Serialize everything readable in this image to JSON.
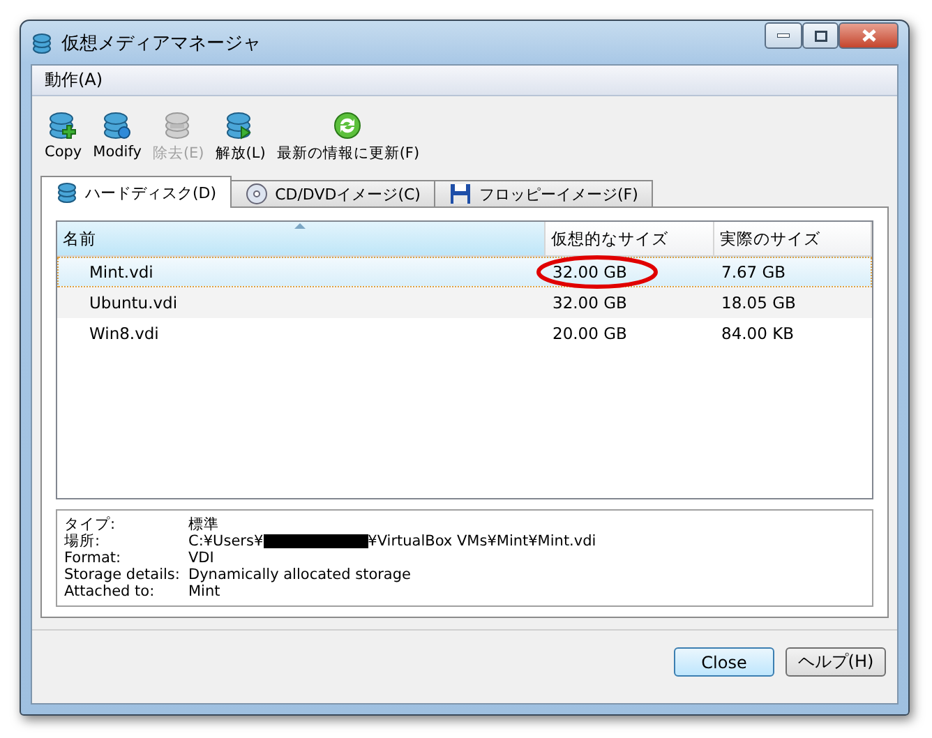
{
  "window": {
    "title": "仮想メディアマネージャ"
  },
  "menu": [
    {
      "label": "動作(A)"
    }
  ],
  "toolbar": [
    {
      "label": "Copy",
      "kind": "copy",
      "disabled": false
    },
    {
      "label": "Modify",
      "kind": "modify",
      "disabled": false
    },
    {
      "label": "除去(E)",
      "kind": "remove",
      "disabled": true
    },
    {
      "label": "解放(L)",
      "kind": "release",
      "disabled": false
    },
    {
      "label": "最新の情報に更新(F)",
      "kind": "refresh",
      "disabled": false
    }
  ],
  "tabs": [
    {
      "label": "ハードディスク(D)",
      "kind": "disk",
      "selected": true
    },
    {
      "label": "CD/DVDイメージ(C)",
      "kind": "cd",
      "selected": false
    },
    {
      "label": "フロッピーイメージ(F)",
      "kind": "floppy",
      "selected": false
    }
  ],
  "table": {
    "columns": [
      "名前",
      "仮想的なサイズ",
      "実際のサイズ"
    ],
    "rows": [
      {
        "name": "Mint.vdi",
        "virtual": "32.00 GB",
        "actual": "7.67 GB",
        "selected": true,
        "circled": true
      },
      {
        "name": "Ubuntu.vdi",
        "virtual": "32.00 GB",
        "actual": "18.05 GB",
        "selected": false,
        "circled": false
      },
      {
        "name": "Win8.vdi",
        "virtual": "20.00 GB",
        "actual": "84.00 KB",
        "selected": false,
        "circled": false
      }
    ]
  },
  "details": [
    {
      "label": "タイプ:",
      "value": [
        "標準"
      ]
    },
    {
      "label": "場所:",
      "value": [
        "C:¥Users¥",
        "¥VirtualBox VMs¥Mint¥Mint.vdi"
      ],
      "redacted": true
    },
    {
      "label": "Format:",
      "value": [
        "VDI"
      ]
    },
    {
      "label": "Storage details:",
      "value": [
        "Dynamically allocated storage"
      ]
    },
    {
      "label": "Attached to:",
      "value": [
        "Mint"
      ]
    }
  ],
  "buttons": [
    {
      "label": "Close",
      "default": true
    },
    {
      "label": "ヘルプ(H)",
      "default": false
    }
  ]
}
